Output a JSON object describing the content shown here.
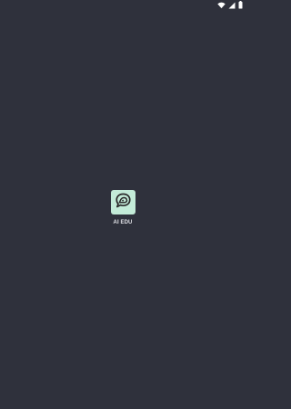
{
  "status_bar": {
    "icons": [
      "wifi-icon",
      "signal-icon",
      "battery-icon"
    ],
    "color": "#ffffff"
  },
  "splash": {
    "app_name": "AI EDU",
    "icon_name": "chat-bubble-logo-icon",
    "icon_background": "#c3ebd8",
    "icon_foreground": "#2b2b2b"
  },
  "theme": {
    "background": "#2f313c",
    "label_color": "#e2e3e8"
  }
}
